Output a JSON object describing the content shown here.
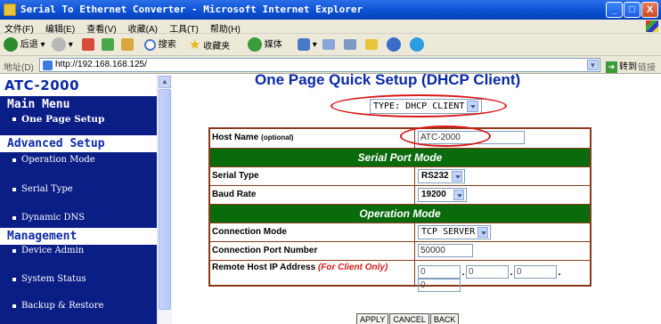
{
  "window": {
    "title": "Serial To Ethernet Converter - Microsoft Internet Explorer",
    "min": "_",
    "max": "□",
    "close": "X"
  },
  "menubar": [
    "文件(F)",
    "编辑(E)",
    "查看(V)",
    "收藏(A)",
    "工具(T)",
    "帮助(H)"
  ],
  "toolbar": {
    "back": "后退",
    "search": "搜索",
    "favorites": "收藏夹",
    "media": "媒体"
  },
  "address": {
    "label": "地址(D)",
    "url": "http://192.168.168.125/",
    "go": "转到",
    "links": "链接"
  },
  "sidebar": {
    "logo": "ATC-2000",
    "main_menu": "Main Menu",
    "one_page_setup": "One Page Setup",
    "advanced_setup": "Advanced Setup",
    "advanced_items": [
      "Operation Mode",
      "Serial Type",
      "Dynamic DNS"
    ],
    "management": "Management",
    "management_items": [
      "Device Admin",
      "System Status",
      "Backup & Restore"
    ]
  },
  "main": {
    "title": "One Page Quick Setup (DHCP Client)",
    "type_select": "TYPE: DHCP CLIENT",
    "host_name_label": "Host Name",
    "host_name_optional": "(optional)",
    "host_name_value": "ATC-2000",
    "serial_section": "Serial Port Mode",
    "serial_type_label": "Serial Type",
    "serial_type_value": "RS232",
    "baud_rate_label": "Baud Rate",
    "baud_rate_value": "19200",
    "operation_section": "Operation Mode",
    "connection_mode_label": "Connection Mode",
    "connection_mode_value": "TCP SERVER",
    "connection_port_label": "Connection Port Number",
    "connection_port_value": "50000",
    "remote_ip_label": "Remote Host  IP Address",
    "remote_ip_note": "(For Client Only)",
    "remote_ip": [
      "0",
      "0",
      "0",
      "0"
    ],
    "buttons": {
      "apply": "APPLY",
      "cancel": "CANCEL",
      "back": "BACK"
    }
  },
  "colors": {
    "sidebar_bg": "#0b1e86",
    "section_green": "#0a6b0c",
    "title_blue": "#0b2aa8",
    "highlight_red": "#d81818",
    "table_border": "#8a3a1a"
  }
}
